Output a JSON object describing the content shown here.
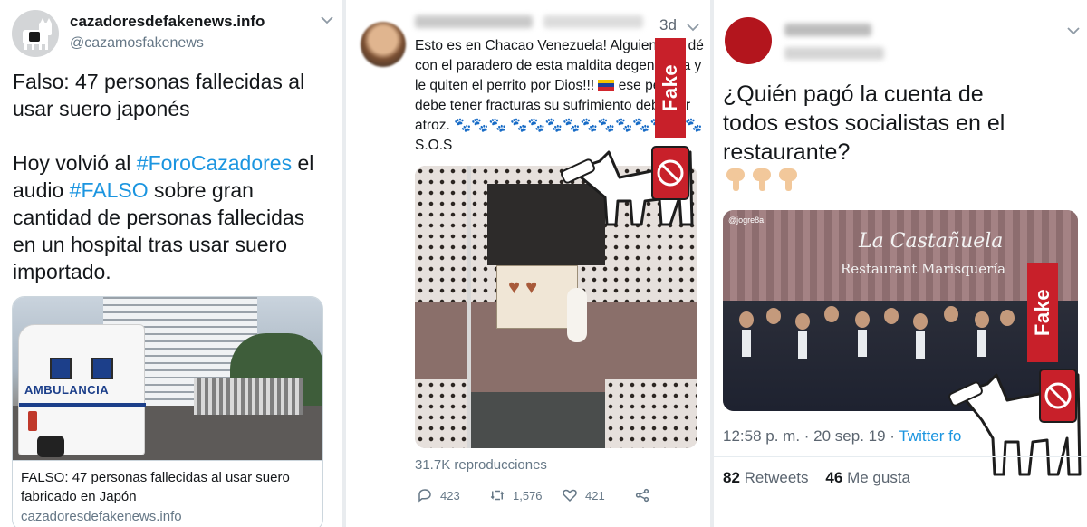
{
  "tweet1": {
    "display_name": "cazadoresdefakenews.info",
    "handle": "@cazamosfakenews",
    "text_line1": "Falso: 47 personas fallecidas al usar suero japonés",
    "text_pre": "Hoy volvió al ",
    "hashtag1": "#ForoCazadores",
    "text_mid": " el audio ",
    "hashtag2": "#FALSO",
    "text_post": " sobre gran cantidad de personas fallecidas en un hospital tras usar suero importado.",
    "card": {
      "image_text": "AMBULANCIA",
      "title": "FALSO: 47 personas fallecidas al usar suero fabricado en Japón",
      "domain": "cazadoresdefakenews.info"
    }
  },
  "tweet2": {
    "timestamp": "3d",
    "text": "Esto es en Chacao Venezuela! Alguien que dé con el paradero de esta maldita degenerada y le quiten el perrito por Dios!!!",
    "text2": " ese perrito debe tener fracturas su sufrimiento debe ser atroz. 🐾🐾🐾 🐾🐾🐾🐾🐾🐾🐾🐾🐾🐾🐾S.O.S",
    "views": "31.7K reproducciones",
    "replies": "423",
    "retweets": "1,576",
    "likes": "421"
  },
  "tweet3": {
    "text": "¿Quién pagó la cuenta de todos estos socialistas en el restaurante?",
    "media_watermark": "@jogre8a",
    "media_sign1": "La Castañuela",
    "media_sign2": "Restaurant  Marisquería",
    "time_text": "12:58 p. m. · 20 sep. 19 · ",
    "source": "Twitter fo",
    "retweets_count": "82",
    "retweets_label": " Retweets",
    "likes_count": "46",
    "likes_label": " Me gusta"
  },
  "stamp": {
    "label": "Fake"
  },
  "colors": {
    "link": "#1b95e0",
    "fake_red": "#c8202a",
    "muted": "#657786"
  }
}
